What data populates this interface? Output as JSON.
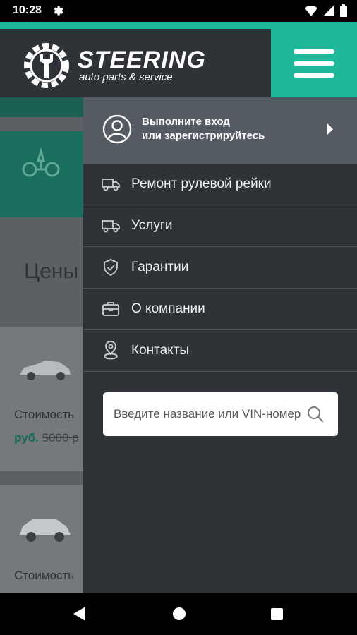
{
  "status_bar": {
    "time": "10:28"
  },
  "header": {
    "logo_title": "STEERING",
    "logo_subtitle": "auto parts & service"
  },
  "background": {
    "prices_heading": "Цены",
    "cards": [
      {
        "cost_label": "Стоимость",
        "price_currency": "руб.",
        "old_price": "5000 р"
      },
      {
        "cost_label": "Стоимость"
      }
    ]
  },
  "drawer": {
    "account_line1": "Выполните вход",
    "account_line2": "или зарегистрируйтесь",
    "items": [
      {
        "label": "Ремонт рулевой рейки",
        "icon": "truck-icon"
      },
      {
        "label": "Услуги",
        "icon": "truck-icon"
      },
      {
        "label": "Гарантии",
        "icon": "shield-check-icon"
      },
      {
        "label": "О компании",
        "icon": "briefcase-icon"
      },
      {
        "label": "Контакты",
        "icon": "map-pin-icon"
      }
    ],
    "search_placeholder": "Введите название или VIN-номер"
  },
  "colors": {
    "accent": "#1fb89b",
    "header_bg": "#2f3338",
    "drawer_bg": "#2f3338",
    "account_bg": "#545b62"
  }
}
